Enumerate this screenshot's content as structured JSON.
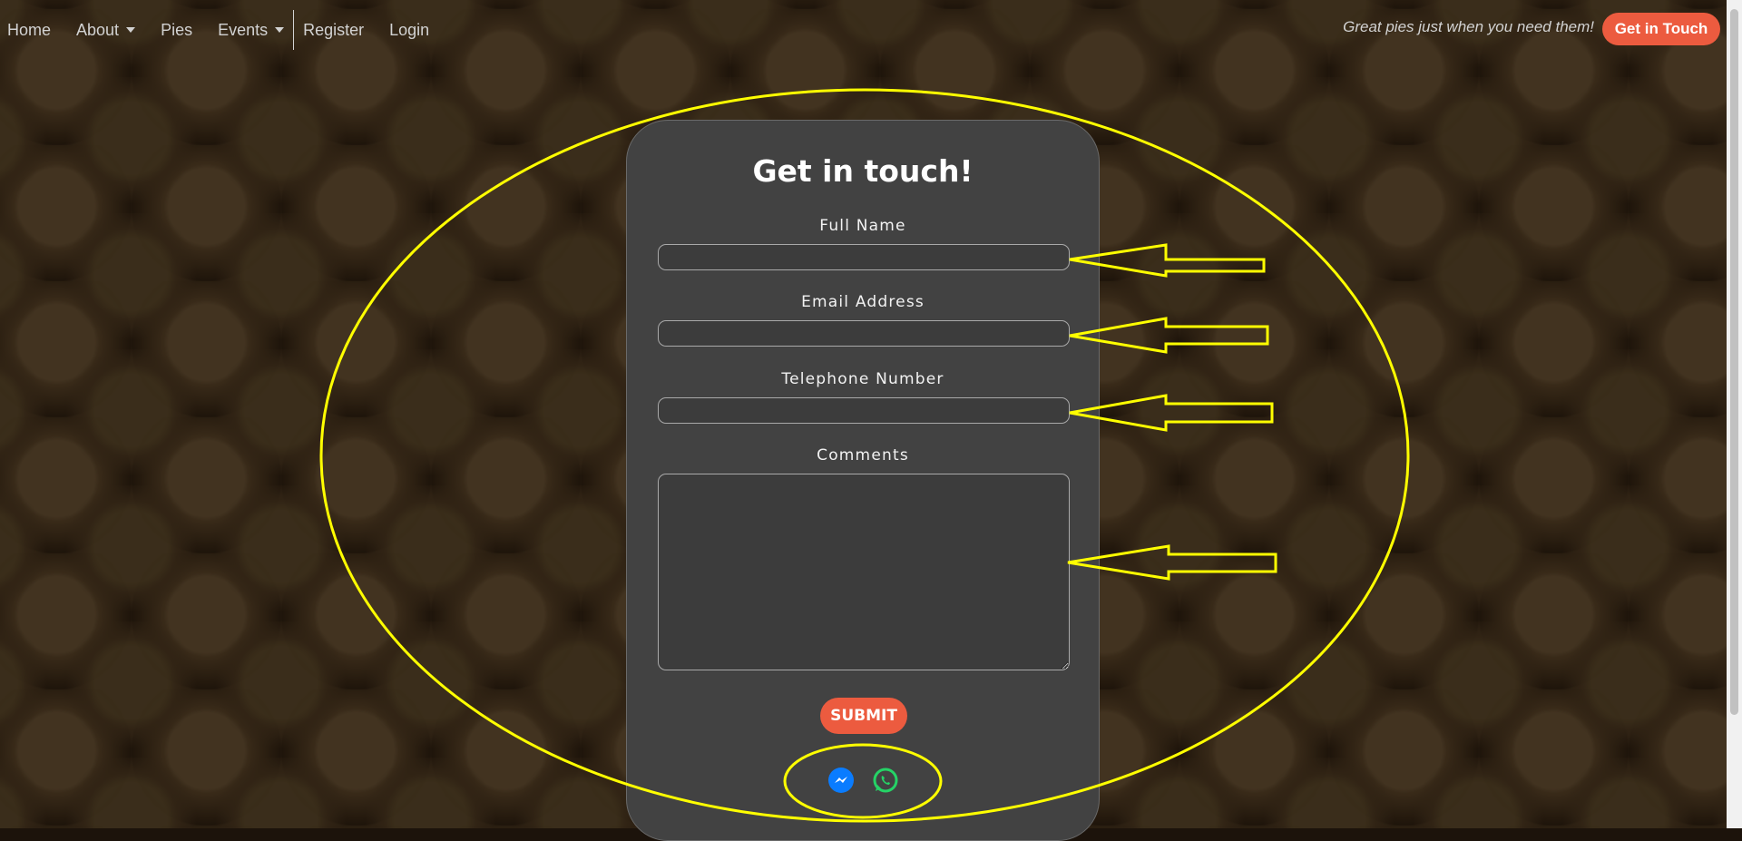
{
  "nav": {
    "home": "Home",
    "about": "About",
    "pies": "Pies",
    "events": "Events",
    "register": "Register",
    "login": "Login",
    "tagline": "Great pies just when you need them!",
    "cta": "Get in Touch"
  },
  "form": {
    "title": "Get in touch!",
    "full_name_label": "Full Name",
    "email_label": "Email Address",
    "telephone_label": "Telephone Number",
    "comments_label": "Comments",
    "full_name_value": "",
    "email_value": "",
    "telephone_value": "",
    "comments_value": "",
    "submit": "SUBMIT"
  },
  "social": [
    "messenger-icon",
    "whatsapp-icon"
  ],
  "colors": {
    "accent": "#ec5b3f",
    "card": "#424242",
    "annotation": "#ffff00",
    "messenger": "#0a7cff",
    "whatsapp": "#25d366"
  }
}
